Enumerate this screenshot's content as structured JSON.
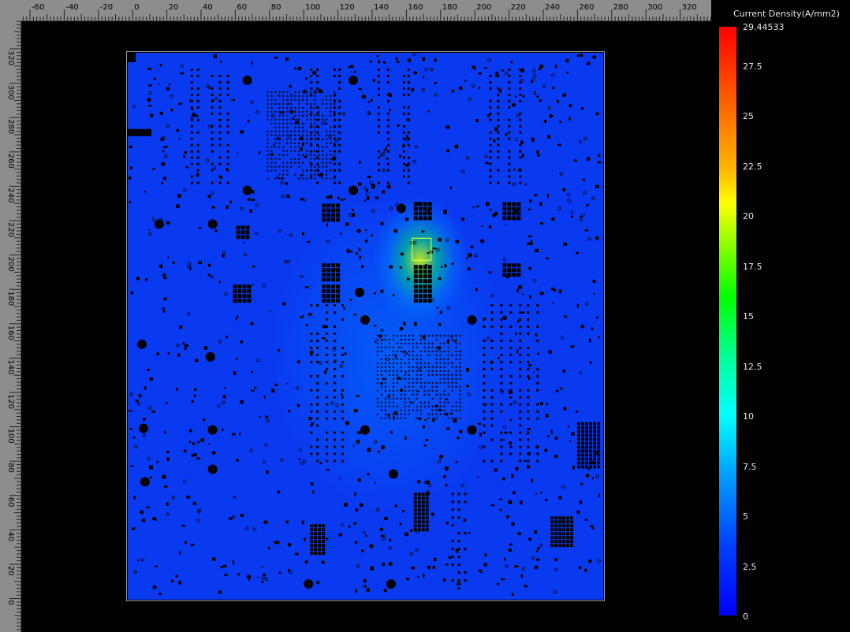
{
  "ruler_top": {
    "labels": [
      "-60",
      "-40",
      "-20",
      "0",
      "20",
      "40",
      "60",
      "80",
      "100",
      "120",
      "140",
      "160",
      "180",
      "200",
      "220",
      "240",
      "260",
      "280",
      "300",
      "320"
    ]
  },
  "ruler_left": {
    "labels": [
      "320",
      "300",
      "280",
      "260",
      "240",
      "220",
      "200",
      "180",
      "160",
      "140",
      "120",
      "100",
      "80",
      "60",
      "40",
      "20",
      "0"
    ]
  },
  "legend": {
    "title": "Current Density(A/mm2)",
    "max_value": "29.44533",
    "values": [
      "27.5",
      "25",
      "22.5",
      "20",
      "17.5",
      "15",
      "12.5",
      "10",
      "7.5",
      "5",
      "2.5",
      "0"
    ]
  },
  "colors": {
    "board_base": "#0a3af0",
    "hotspot": "#d4ff00",
    "features": "#000000",
    "ruler_bg": "#8d8d8d",
    "frame": "#9a9a9a"
  }
}
